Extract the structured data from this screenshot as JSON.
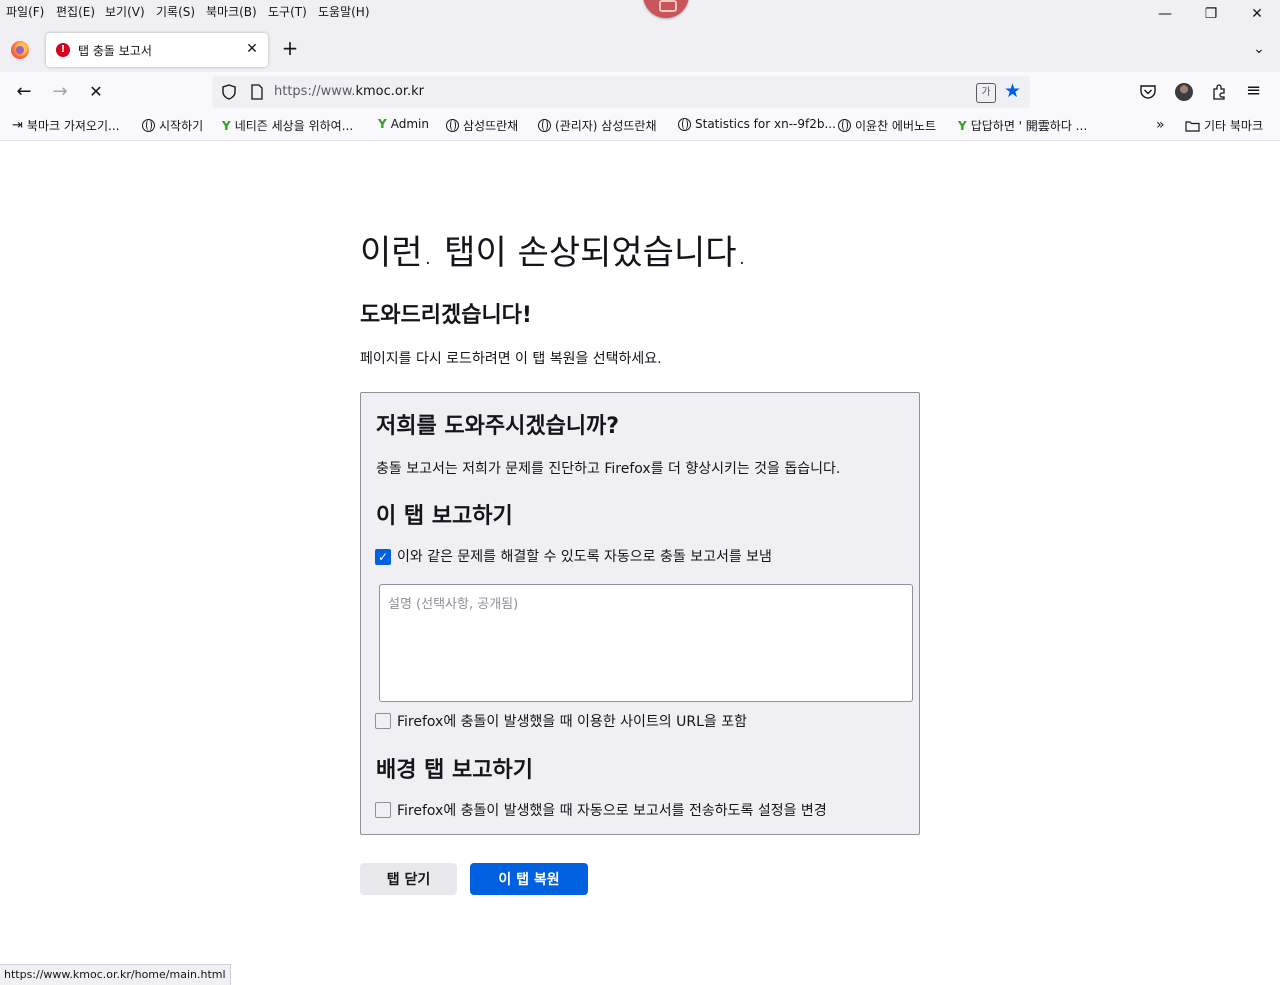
{
  "menu": {
    "items": [
      "파일(F)",
      "편집(E)",
      "보기(V)",
      "기록(S)",
      "북마크(B)",
      "도구(T)",
      "도움말(H)"
    ]
  },
  "window_controls": {
    "minimize": "—",
    "restore": "❐",
    "close": "✕"
  },
  "tab": {
    "title": "탭 충돌 보고서",
    "icon_text": "!"
  },
  "nav": {
    "url_prefix": "https://www.",
    "url_domain": "kmoc.or.kr"
  },
  "bookmarks": {
    "items": [
      "북마크 가져오기...",
      "시작하기",
      "네티즌 세상을 위하여...",
      "Admin",
      "삼성뜨란채",
      "(관리자) 삼성뜨란채",
      "Statistics for xn--9f2b...",
      "이윤찬 에버노트",
      "답답하면 ' 開雲하다 ..."
    ],
    "other": "기타 북마크"
  },
  "page": {
    "title": "이런. 탭이 손상되었습니다.",
    "subtitle": "도와드리겠습니다!",
    "description": "페이지를 다시 로드하려면 이 탭 복원을 선택하세요.",
    "report": {
      "heading": "저희를 도와주시겠습니까?",
      "intro": "충돌 보고서는 저희가 문제를 진단하고 Firefox를 더 향상시키는 것을 돕습니다.",
      "this_tab_heading": "이 탭 보고하기",
      "auto_send_label": "이와 같은 문제를 해결할 수 있도록 자동으로 충돌 보고서를 보냄",
      "auto_send_checked": true,
      "comment_placeholder": "설명 (선택사항, 공개됨)",
      "include_url_label": "Firefox에 충돌이 발생했을 때 이용한 사이트의 URL을 포함",
      "include_url_checked": false,
      "background_heading": "배경 탭 보고하기",
      "background_label": "Firefox에 충돌이 발생했을 때 자동으로 보고서를 전송하도록 설정을 변경",
      "background_checked": false
    },
    "buttons": {
      "close_tab": "탭 닫기",
      "restore_tab": "이 탭 복원"
    }
  },
  "status_bar": {
    "url": "https://www.kmoc.or.kr/home/main.html"
  },
  "colors": {
    "accent": "#0061e0",
    "error": "#d70022",
    "chrome_bg": "#f0f0f4"
  }
}
